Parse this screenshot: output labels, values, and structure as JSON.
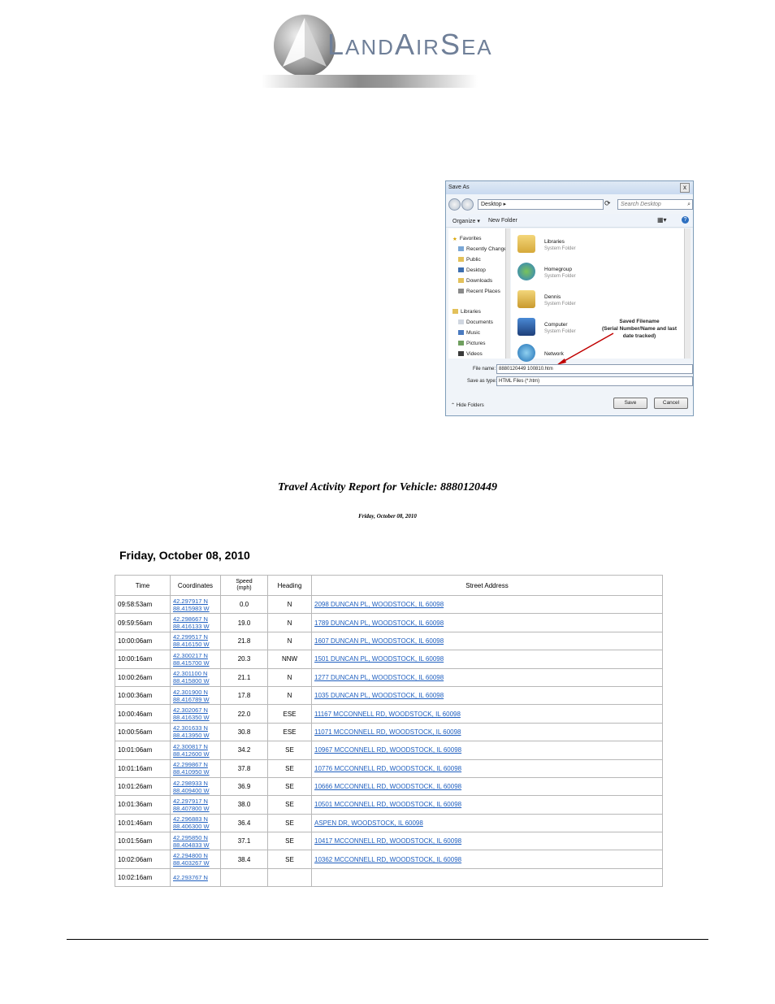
{
  "logo": {
    "text_L": "L",
    "text_and": "AND",
    "text_A": "A",
    "text_ir": "IR",
    "text_S": "S",
    "text_ea": "EA"
  },
  "dialog": {
    "title": "Save As",
    "close": "x",
    "address": "Desktop ▸",
    "search_placeholder": "Search Desktop",
    "toolbar": {
      "organize": "Organize ▾",
      "new_folder": "New Folder"
    },
    "nav_items": [
      {
        "label": "Favorites"
      },
      {
        "label": "Recently Change"
      },
      {
        "label": "Public"
      },
      {
        "label": "Desktop"
      },
      {
        "label": "Downloads"
      },
      {
        "label": "Recent Places"
      },
      {
        "label": "Libraries"
      },
      {
        "label": "Documents"
      },
      {
        "label": "Music"
      },
      {
        "label": "Pictures"
      },
      {
        "label": "Videos"
      }
    ],
    "entries": [
      {
        "name": "Libraries",
        "sub": "System Folder"
      },
      {
        "name": "Homegroup",
        "sub": "System Folder"
      },
      {
        "name": "Dennis",
        "sub": "System Folder"
      },
      {
        "name": "Computer",
        "sub": "System Folder"
      },
      {
        "name": "Network",
        "sub": ""
      }
    ],
    "callout": [
      "Saved Filename",
      "(Serial Number/Name and last",
      "date tracked)"
    ],
    "file_name_label": "File name:",
    "file_name_value": "8880120449 100810.htm",
    "save_type_label": "Save as type:",
    "save_type_value": "HTML Files (*.htm)",
    "hide_folders": "Hide Folders",
    "save_button": "Save",
    "cancel_button": "Cancel"
  },
  "report": {
    "title": "Travel Activity Report for Vehicle: 8880120449",
    "subtitle": "Friday, October 08, 2010",
    "day_heading": "Friday, October 08, 2010",
    "columns": {
      "time": "Time",
      "coordinates": "Coordinates",
      "speed_1": "Speed",
      "speed_2": "(mph)",
      "heading": "Heading",
      "address": "Street Address"
    },
    "rows": [
      {
        "time": "09:58:53am",
        "lat": "42.297917 N",
        "lon": "88.415983 W",
        "speed": "0.0",
        "heading": "N",
        "address": "2098 DUNCAN PL, WOODSTOCK, IL 60098"
      },
      {
        "time": "09:59:56am",
        "lat": "42.298667 N",
        "lon": "88.416133 W",
        "speed": "19.0",
        "heading": "N",
        "address": "1789 DUNCAN PL, WOODSTOCK, IL 60098"
      },
      {
        "time": "10:00:06am",
        "lat": "42.299517 N",
        "lon": "88.416150 W",
        "speed": "21.8",
        "heading": "N",
        "address": "1607 DUNCAN PL, WOODSTOCK, IL 60098"
      },
      {
        "time": "10:00:16am",
        "lat": "42.300217 N",
        "lon": "88.415700 W",
        "speed": "20.3",
        "heading": "NNW",
        "address": "1501 DUNCAN PL, WOODSTOCK, IL 60098"
      },
      {
        "time": "10:00:26am",
        "lat": "42.301100 N",
        "lon": "88.415800 W",
        "speed": "21.1",
        "heading": "N",
        "address": "1277 DUNCAN PL, WOODSTOCK, IL 60098"
      },
      {
        "time": "10:00:36am",
        "lat": "42.301900 N",
        "lon": "88.416789 W",
        "speed": "17.8",
        "heading": "N",
        "address": "1035 DUNCAN PL, WOODSTOCK, IL 60098"
      },
      {
        "time": "10:00:46am",
        "lat": "42.302067 N",
        "lon": "88.416350 W",
        "speed": "22.0",
        "heading": "ESE",
        "address": "11167 MCCONNELL RD, WOODSTOCK, IL 60098"
      },
      {
        "time": "10:00:56am",
        "lat": "42.301633 N",
        "lon": "88.413950 W",
        "speed": "30.8",
        "heading": "ESE",
        "address": "11071 MCCONNELL RD, WOODSTOCK, IL 60098"
      },
      {
        "time": "10:01:06am",
        "lat": "42.300817 N",
        "lon": "88.412600 W",
        "speed": "34.2",
        "heading": "SE",
        "address": "10967 MCCONNELL RD, WOODSTOCK, IL 60098"
      },
      {
        "time": "10:01:16am",
        "lat": "42.299867 N",
        "lon": "88.410950 W",
        "speed": "37.8",
        "heading": "SE",
        "address": "10776 MCCONNELL RD, WOODSTOCK, IL 60098"
      },
      {
        "time": "10:01:26am",
        "lat": "42.298933 N",
        "lon": "88.409400 W",
        "speed": "36.9",
        "heading": "SE",
        "address": "10666 MCCONNELL RD, WOODSTOCK, IL 60098"
      },
      {
        "time": "10:01:36am",
        "lat": "42.297917 N",
        "lon": "88.407800 W",
        "speed": "38.0",
        "heading": "SE",
        "address": "10501 MCCONNELL RD, WOODSTOCK, IL 60098"
      },
      {
        "time": "10:01:46am",
        "lat": "42.296883 N",
        "lon": "88.406300 W",
        "speed": "36.4",
        "heading": "SE",
        "address": "ASPEN DR, WOODSTOCK, IL 60098"
      },
      {
        "time": "10:01:56am",
        "lat": "42.295850 N",
        "lon": "88.404833 W",
        "speed": "37.1",
        "heading": "SE",
        "address": "10417 MCCONNELL RD, WOODSTOCK, IL 60098"
      },
      {
        "time": "10:02:06am",
        "lat": "42.294800 N",
        "lon": "88.403267 W",
        "speed": "38.4",
        "heading": "SE",
        "address": "10362 MCCONNELL RD, WOODSTOCK, IL 60098"
      },
      {
        "time": "10:02:16am",
        "lat": "42.293767 N",
        "lon": "",
        "speed": "",
        "heading": "",
        "address": ""
      }
    ]
  },
  "colors": {
    "link": "#1f5fbf",
    "logo_text": "#6f7f98",
    "grid": "#b8b8b8"
  }
}
